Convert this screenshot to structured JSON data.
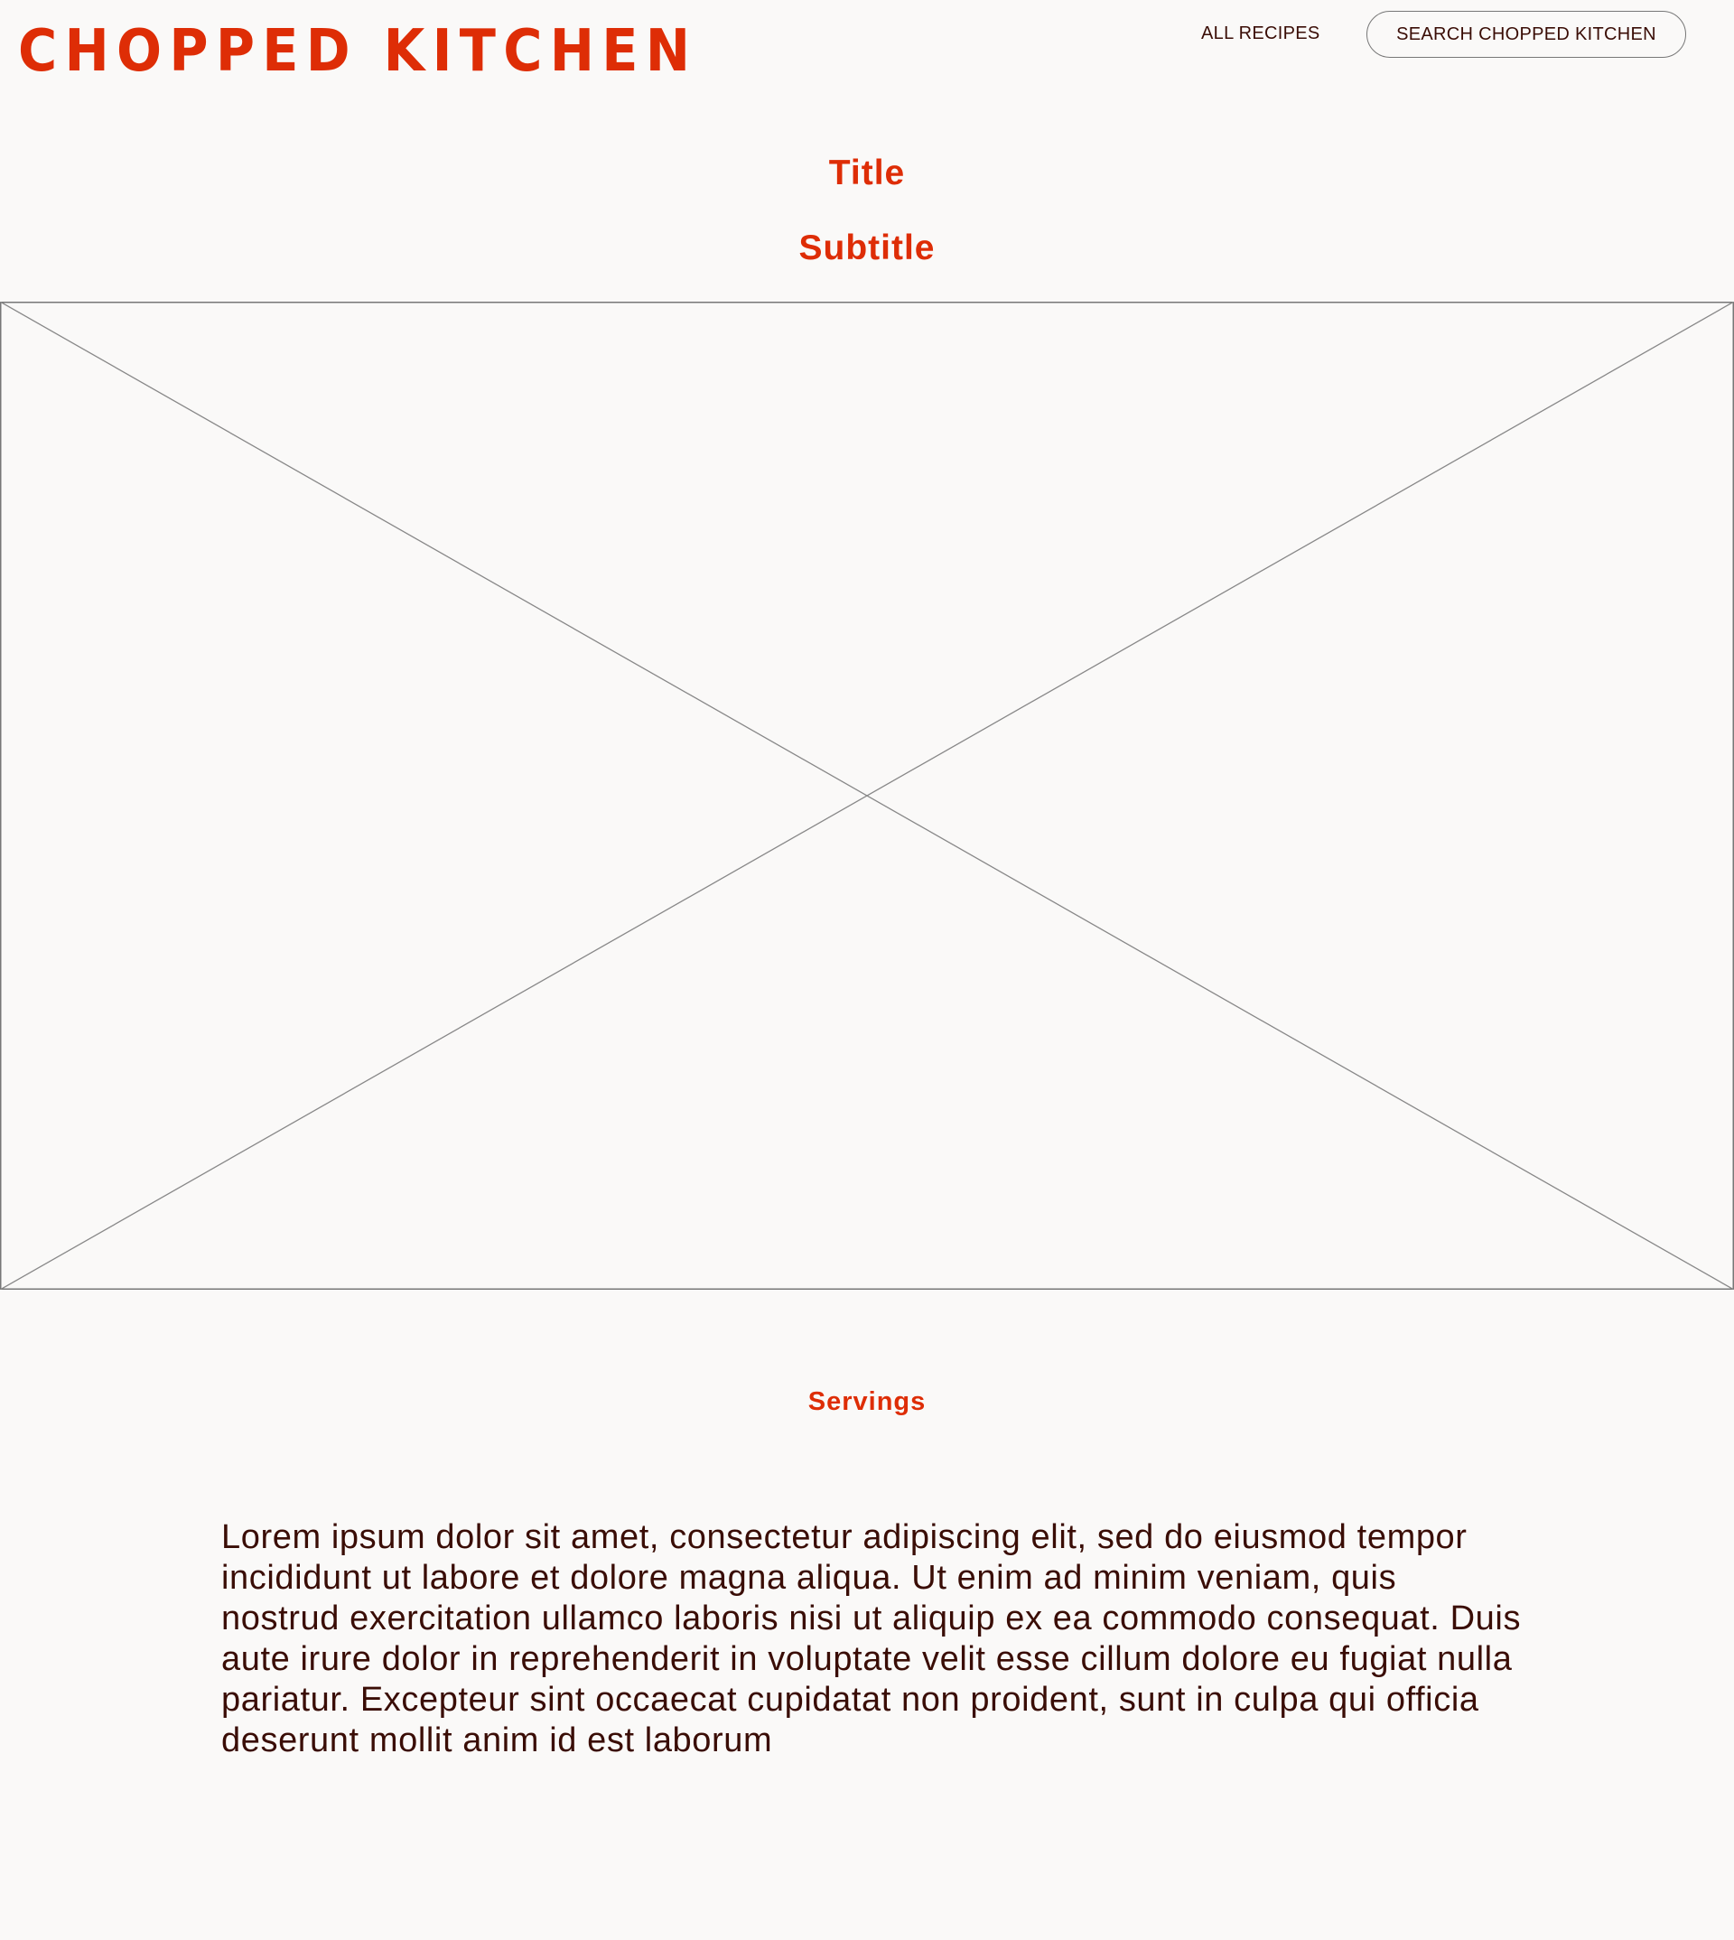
{
  "header": {
    "logo": "CHOPPED KITCHEN",
    "nav": {
      "all_recipes": "ALL RECIPES",
      "search_label": "SEARCH CHOPPED KITCHEN"
    }
  },
  "recipe": {
    "title": "Title",
    "subtitle": "Subtitle",
    "image_placeholder": "image-placeholder-icon",
    "servings_label": "Servings",
    "description": "Lorem ipsum dolor sit amet, consectetur adipiscing elit, sed do eiusmod tempor incididunt ut labore et dolore magna aliqua. Ut enim ad minim veniam, quis nostrud exercitation ullamco laboris nisi ut aliquip ex ea commodo consequat. Duis aute irure dolor in reprehenderit in voluptate velit esse cillum dolore eu fugiat nulla pariatur. Excepteur sint occaecat cupidatat non proident, sunt in culpa qui officia deserunt mollit anim id est laborum"
  },
  "colors": {
    "brand": "#de2d06",
    "text": "#3a0d06",
    "background": "#faf9f8",
    "placeholder_stroke": "#777777"
  }
}
